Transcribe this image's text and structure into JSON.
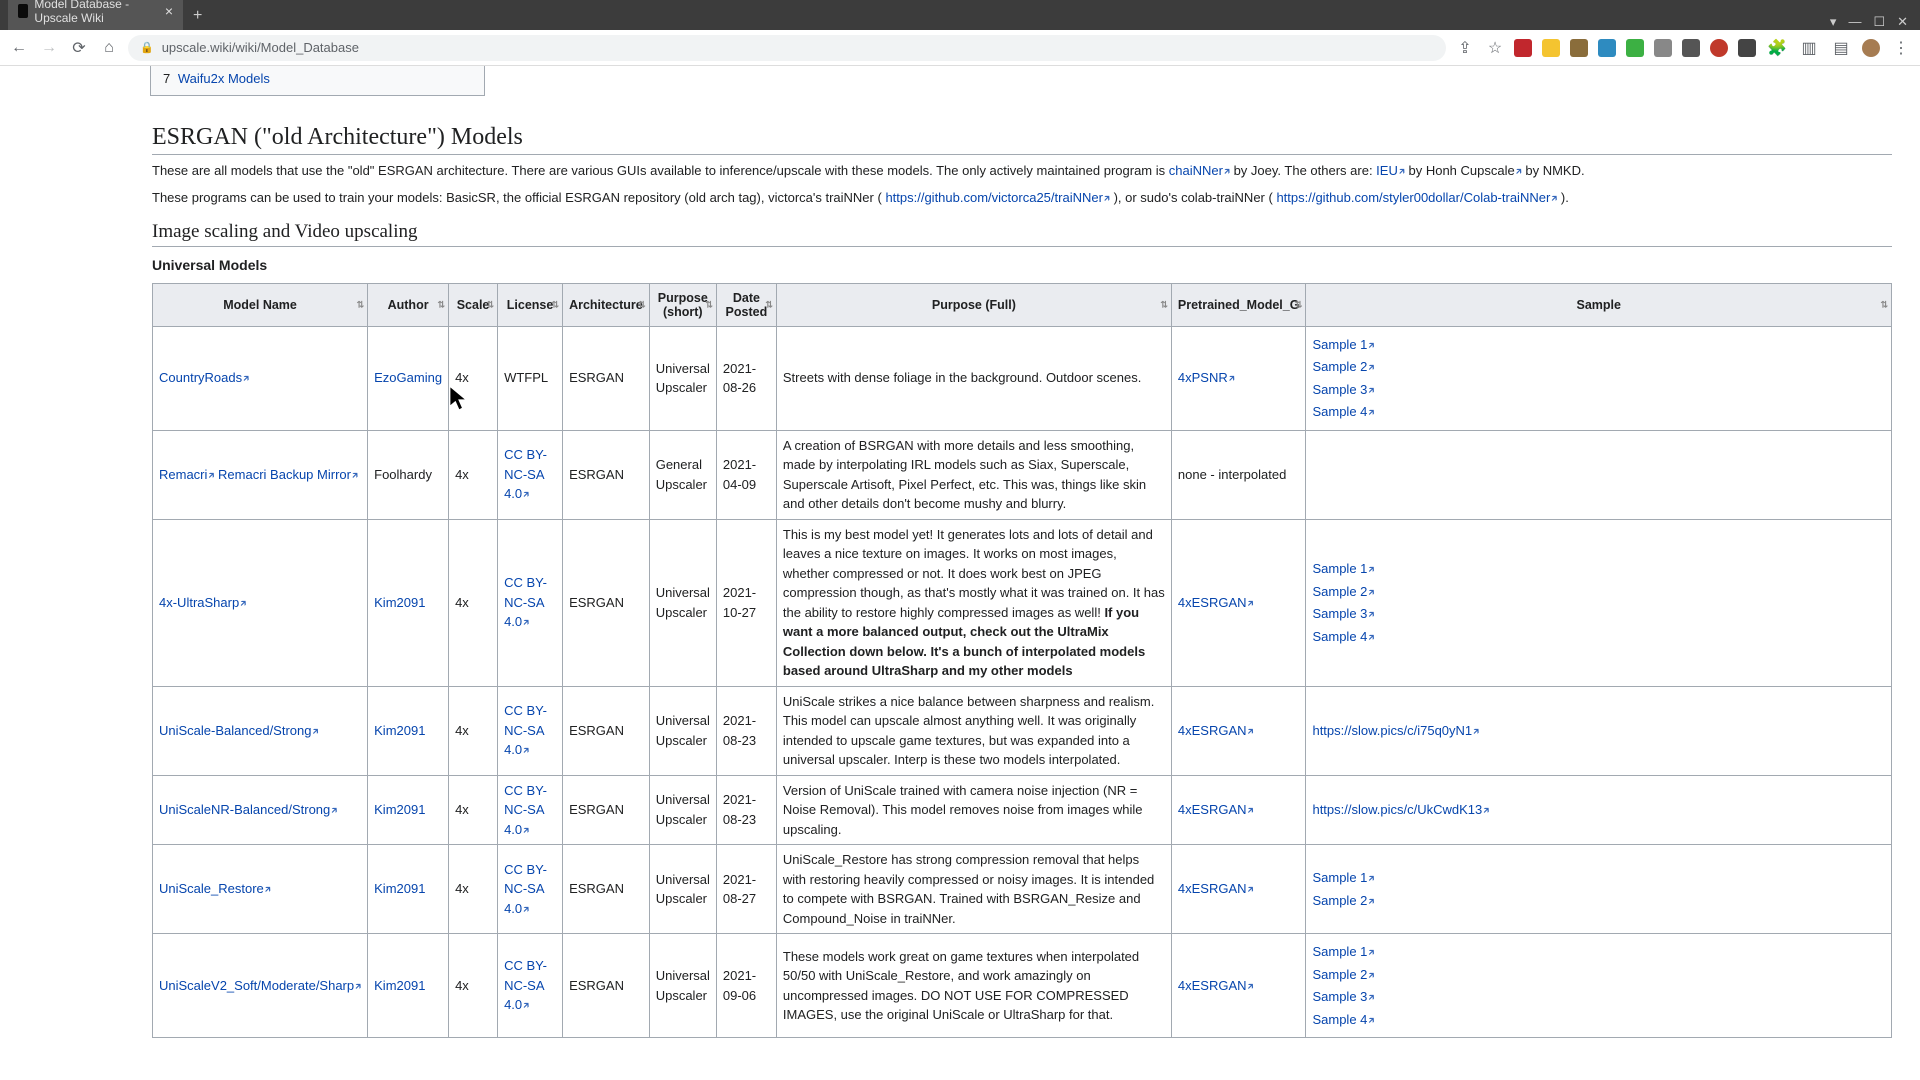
{
  "browser": {
    "tab_title": "Model Database - Upscale Wiki",
    "url": "upscale.wiki/wiki/Model_Database"
  },
  "toc": {
    "items": [
      {
        "num": "7",
        "label": "Waifu2x Models"
      }
    ]
  },
  "sections": {
    "esrgan_heading": "ESRGAN (\"old Architecture\") Models",
    "intro_p1_a": "These are all models that use the \"old\" ESRGAN architecture. There are various GUIs available to inference/upscale with these models. The only actively maintained program is ",
    "intro_chainner": "chaiNNer",
    "intro_p1_b": " by Joey. The others are: ",
    "intro_ieu": "IEU",
    "intro_p1_c": " by Honh Cupscale",
    "intro_p1_d": " by NMKD.",
    "intro_p2_a": "These programs can be used to train your models: BasicSR, the official ESRGAN repository (old arch tag), victorca's traiNNer (",
    "intro_trainner_url": "https://github.com/victorca25/traiNNer",
    "intro_p2_b": "), or sudo's colab-traiNNer (",
    "intro_colab_url": "https://github.com/styler00dollar/Colab-traiNNer",
    "intro_p2_c": ").",
    "scaling_heading": "Image scaling and Video upscaling",
    "universal_heading": "Universal Models"
  },
  "table": {
    "headers": {
      "name": "Model Name",
      "author": "Author",
      "scale": "Scale",
      "license": "License",
      "arch": "Architecture",
      "short": "Purpose (short)",
      "date": "Date Posted",
      "full": "Purpose (Full)",
      "pretrain": "Pretrained_Model_G",
      "sample": "Sample"
    },
    "rows": [
      {
        "name_links": [
          "CountryRoads"
        ],
        "author": "EzoGaming",
        "author_link": true,
        "scale": "4x",
        "license": "WTFPL",
        "license_link": false,
        "arch": "ESRGAN",
        "short": "Universal Upscaler",
        "date": "2021-08-26",
        "full": "Streets with dense foliage in the background. Outdoor scenes.",
        "full_bold": "",
        "pretrain": "4xPSNR",
        "pretrain_plain": "",
        "samples": [
          "Sample 1",
          "Sample 2",
          "Sample 3",
          "Sample 4"
        ]
      },
      {
        "name_links": [
          "Remacri",
          "Remacri Backup Mirror"
        ],
        "author": "Foolhardy",
        "author_link": false,
        "scale": "4x",
        "license": "CC BY-NC-SA 4.0",
        "license_link": true,
        "arch": "ESRGAN",
        "short": "General Upscaler",
        "date": "2021-04-09",
        "full": "A creation of BSRGAN with more details and less smoothing, made by interpolating IRL models such as Siax, Superscale, Superscale Artisoft, Pixel Perfect, etc. This was, things like skin and other details don't become mushy and blurry.",
        "full_bold": "",
        "pretrain": "",
        "pretrain_plain": "none - interpolated",
        "samples": []
      },
      {
        "name_links": [
          "4x-UltraSharp"
        ],
        "author": "Kim2091",
        "author_link": true,
        "scale": "4x",
        "license": "CC BY-NC-SA 4.0",
        "license_link": true,
        "arch": "ESRGAN",
        "short": "Universal Upscaler",
        "date": "2021-10-27",
        "full": "This is my best model yet! It generates lots and lots of detail and leaves a nice texture on images. It works on most images, whether compressed or not. It does work best on JPEG compression though, as that's mostly what it was trained on. It has the ability to restore highly compressed images as well! ",
        "full_bold": "If you want a more balanced output, check out the UltraMix Collection down below. It's a bunch of interpolated models based around UltraSharp and my other models",
        "pretrain": "4xESRGAN",
        "pretrain_plain": "",
        "samples": [
          "Sample 1",
          "Sample 2",
          "Sample 3",
          "Sample 4"
        ]
      },
      {
        "name_links": [
          "UniScale-Balanced/Strong"
        ],
        "author": "Kim2091",
        "author_link": true,
        "scale": "4x",
        "license": "CC BY-NC-SA 4.0",
        "license_link": true,
        "arch": "ESRGAN",
        "short": "Universal Upscaler",
        "date": "2021-08-23",
        "full": "UniScale strikes a nice balance between sharpness and realism. This model can upscale almost anything well. It was originally intended to upscale game textures, but was expanded into a universal upscaler. Interp is these two models interpolated.",
        "full_bold": "",
        "pretrain": "4xESRGAN",
        "pretrain_plain": "",
        "samples": [
          "https://slow.pics/c/i75q0yN1"
        ]
      },
      {
        "name_links": [
          "UniScaleNR-Balanced/Strong"
        ],
        "author": "Kim2091",
        "author_link": true,
        "scale": "4x",
        "license": "CC BY-NC-SA 4.0",
        "license_link": true,
        "arch": "ESRGAN",
        "short": "Universal Upscaler",
        "date": "2021-08-23",
        "full": "Version of UniScale trained with camera noise injection (NR = Noise Removal). This model removes noise from images while upscaling.",
        "full_bold": "",
        "pretrain": "4xESRGAN",
        "pretrain_plain": "",
        "samples": [
          "https://slow.pics/c/UkCwdK13"
        ]
      },
      {
        "name_links": [
          "UniScale_Restore"
        ],
        "author": "Kim2091",
        "author_link": true,
        "scale": "4x",
        "license": "CC BY-NC-SA 4.0",
        "license_link": true,
        "arch": "ESRGAN",
        "short": "Universal Upscaler",
        "date": "2021-08-27",
        "full": "UniScale_Restore has strong compression removal that helps with restoring heavily compressed or noisy images. It is intended to compete with BSRGAN. Trained with BSRGAN_Resize and Compound_Noise in traiNNer.",
        "full_bold": "",
        "pretrain": "4xESRGAN",
        "pretrain_plain": "",
        "samples": [
          "Sample 1",
          "Sample 2"
        ]
      },
      {
        "name_links": [
          "UniScaleV2_Soft/Moderate/Sharp"
        ],
        "author": "Kim2091",
        "author_link": true,
        "scale": "4x",
        "license": "CC BY-NC-SA 4.0",
        "license_link": true,
        "arch": "ESRGAN",
        "short": "Universal Upscaler",
        "date": "2021-09-06",
        "full": "These models work great on game textures when interpolated 50/50 with UniScale_Restore, and work amazingly on uncompressed images. DO NOT USE FOR COMPRESSED IMAGES, use the original UniScale or UltraSharp for that.",
        "full_bold": "",
        "pretrain": "4xESRGAN",
        "pretrain_plain": "",
        "samples": [
          "Sample 1",
          "Sample 2",
          "Sample 3",
          "Sample 4"
        ]
      }
    ]
  }
}
